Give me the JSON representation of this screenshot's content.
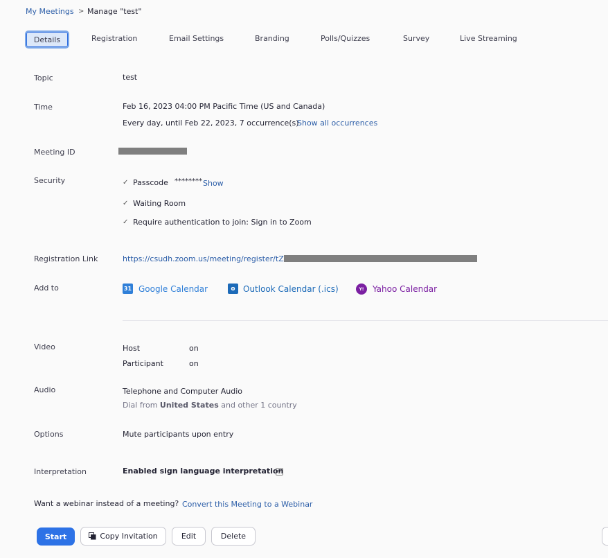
{
  "breadcrumb": {
    "parent": "My Meetings",
    "separator": ">",
    "current": "Manage \"test\""
  },
  "tabs": [
    "Details",
    "Registration",
    "Email Settings",
    "Branding",
    "Polls/Quizzes",
    "Survey",
    "Live Streaming"
  ],
  "topic": {
    "label": "Topic",
    "value": "test"
  },
  "time": {
    "label": "Time",
    "value": "Feb 16, 2023 04:00 PM Pacific Time (US and Canada)",
    "recurrence": "Every day, until Feb 22, 2023, 7 occurrence(s)",
    "show_all": "Show all occurrences"
  },
  "meeting_id": {
    "label": "Meeting ID"
  },
  "security": {
    "label": "Security",
    "passcode_label": "Passcode",
    "passcode_value": "********",
    "show": "Show",
    "waiting_room": "Waiting Room",
    "auth": "Require authentication to join: Sign in to Zoom"
  },
  "registration": {
    "label": "Registration Link",
    "url": "https://csudh.zoom.us/meeting/register/tZ"
  },
  "add_to": {
    "label": "Add to",
    "google": "Google Calendar",
    "outlook": "Outlook Calendar (.ics)",
    "yahoo": "Yahoo Calendar",
    "google_icon_text": "31",
    "outlook_icon_text": "o",
    "yahoo_icon_text": "Y!"
  },
  "video": {
    "label": "Video",
    "host_label": "Host",
    "host_value": "on",
    "participant_label": "Participant",
    "participant_value": "on"
  },
  "audio": {
    "label": "Audio",
    "value": "Telephone and Computer Audio",
    "dial_prefix": "Dial from",
    "dial_country": "United States",
    "dial_suffix": "and other 1 country"
  },
  "options": {
    "label": "Options",
    "value": "Mute participants upon entry"
  },
  "interpretation": {
    "label": "Interpretation",
    "value": "Enabled sign language interpretation",
    "icon_text": "V"
  },
  "webinar": {
    "prompt": "Want a webinar instead of a meeting?",
    "link": "Convert this Meeting to a Webinar"
  },
  "buttons": {
    "start": "Start",
    "copy": "Copy Invitation",
    "edit": "Edit",
    "delete": "Delete"
  },
  "colors": {
    "link": "#2c5ea8",
    "primary": "#2d72e6",
    "google": "#2f7fd8",
    "outlook": "#1c6ab8",
    "yahoo": "#7b1fa2"
  }
}
